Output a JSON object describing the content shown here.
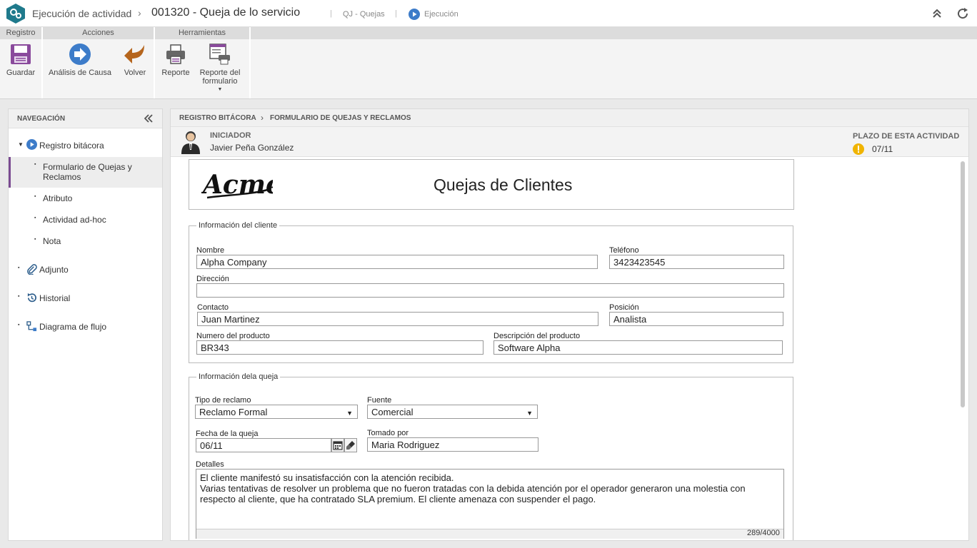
{
  "topbar": {
    "title": "Ejecución de actividad",
    "separator": "›",
    "record": "001320 - Queja de lo servicio",
    "divider": "|",
    "process": "QJ - Quejas",
    "status": "Ejecución"
  },
  "ribbon": {
    "groups": [
      "Registro",
      "Acciones",
      "Herramientas"
    ],
    "buttons": {
      "save": "Guardar",
      "cause_analysis": "Análisis de Causa",
      "back": "Volver",
      "report": "Reporte",
      "form_report_line1": "Reporte del",
      "form_report_line2": "formulario",
      "form_report_caret": "▼"
    }
  },
  "nav": {
    "title": "NAVEGACIÓN",
    "items": [
      {
        "label": "Registro bitácora",
        "bullet": "▼"
      },
      {
        "label_line1": "Formulario de Quejas y",
        "label_line2": "Reclamos",
        "bullet": "▪"
      },
      {
        "label": "Atributo",
        "bullet": "▪"
      },
      {
        "label": "Actividad ad-hoc",
        "bullet": "▪"
      },
      {
        "label": "Nota",
        "bullet": "▪"
      },
      {
        "label": "Adjunto",
        "bullet": "▪"
      },
      {
        "label": "Historial",
        "bullet": "▪"
      },
      {
        "label": "Diagrama de flujo",
        "bullet": "▪"
      }
    ]
  },
  "content": {
    "breadcrumb": {
      "part1": "REGISTRO BITÁCORA",
      "sep": "›",
      "part2": "FORMULARIO DE QUEJAS Y RECLAMOS"
    },
    "initiator_label": "INICIADOR",
    "initiator_name": "Javier Peña González",
    "deadline_label": "PLAZO DE ESTA ACTIVIDAD",
    "deadline_value": "07/11"
  },
  "form": {
    "logo_text": "Acme",
    "title": "Quejas de Clientes",
    "client_section": {
      "legend": "Información del cliente",
      "name_label": "Nombre",
      "name_value": "Alpha Company",
      "phone_label": "Teléfono",
      "phone_value": "3423423545",
      "address_label": "Dirección",
      "address_value": "",
      "contact_label": "Contacto",
      "contact_value": "Juan Martinez",
      "position_label": "Posición",
      "position_value": "Analista",
      "product_num_label": "Numero del producto",
      "product_num_value": "BR343",
      "product_desc_label": "Descripción del producto",
      "product_desc_value": "Software Alpha"
    },
    "complaint_section": {
      "legend": "Información dela queja",
      "type_label": "Tipo de reclamo",
      "type_value": "Reclamo Formal",
      "source_label": "Fuente",
      "source_value": "Comercial",
      "date_label": "Fecha de la queja",
      "date_value": "06/11",
      "taken_label": "Tomado por",
      "taken_value": "Maria Rodriguez",
      "details_label": "Detalles",
      "details_line1": "El cliente manifestó su insatisfacción con la atención recibida.",
      "details_line2": "Varias tentativas de resolver un problema que no fueron tratadas con la debida atención por el operador generaron una molestia con",
      "details_line3": "respecto al cliente, que ha contratado SLA premium. El cliente amenaza con suspender el pago.",
      "char_count": "289/4000",
      "dropdown_arrow": "▼"
    }
  },
  "colors": {
    "accent_purple": "#7a4b91",
    "logo_teal": "#1f7a8c",
    "play_blue": "#3d7cc9",
    "warning": "#f0b400"
  }
}
